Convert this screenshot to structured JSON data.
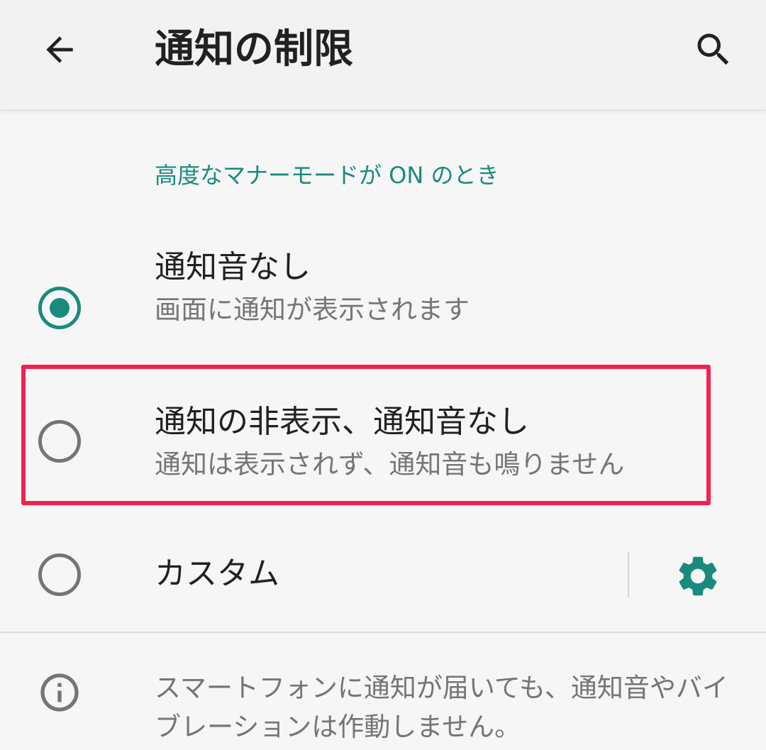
{
  "appbar": {
    "title": "通知の制限",
    "back_icon": "arrow-back-icon",
    "search_icon": "search-icon"
  },
  "section": {
    "header": "高度なマナーモードが ON のとき"
  },
  "options": [
    {
      "title": "通知音なし",
      "summary": "画面に通知が表示されます",
      "selected": true
    },
    {
      "title": "通知の非表示、通知音なし",
      "summary": "通知は表示されず、通知音も鳴りません",
      "selected": false
    },
    {
      "title": "カスタム",
      "selected": false,
      "settings_icon": "gear-icon"
    }
  ],
  "info": {
    "icon": "info-icon",
    "text": "スマートフォンに通知が届いても、通知音やバイブレーションは作動しません。"
  },
  "colors": {
    "accent": "#1a8a7e",
    "highlight": "#f0224f",
    "primary_text": "#212121",
    "secondary_text": "#757575"
  }
}
